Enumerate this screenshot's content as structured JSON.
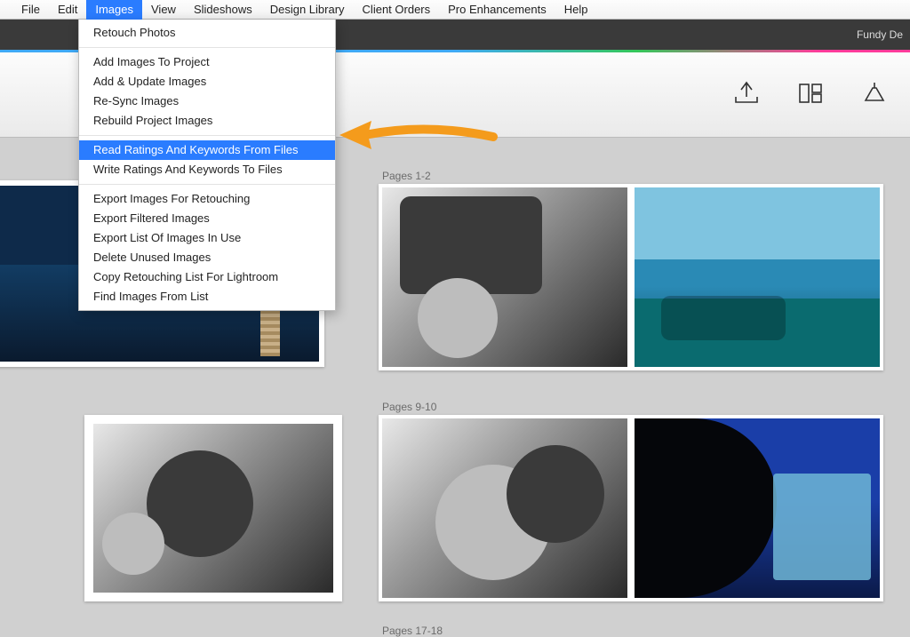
{
  "menubar": {
    "items": [
      "File",
      "Edit",
      "Images",
      "View",
      "Slideshows",
      "Design Library",
      "Client Orders",
      "Pro Enhancements",
      "Help"
    ],
    "open_index": 2
  },
  "titlebar": {
    "right_text": "Fundy De"
  },
  "dropdown": {
    "groups": [
      [
        "Retouch Photos"
      ],
      [
        "Add Images To Project",
        "Add & Update Images",
        "Re-Sync Images",
        "Rebuild Project Images"
      ],
      [
        "Read Ratings And Keywords From Files",
        "Write Ratings And Keywords To Files"
      ],
      [
        "Export Images For Retouching",
        "Export Filtered Images",
        "Export List Of Images In Use",
        "Delete Unused Images",
        "Copy Retouching List For Lightroom",
        "Find Images From List"
      ]
    ],
    "highlighted": "Read Ratings And Keywords From Files"
  },
  "toolbar_icons": [
    "export-icon",
    "layout-icon",
    "share-icon"
  ],
  "spreads": [
    {
      "label": "Pages 1-2"
    },
    {
      "label": "Pages 9-10"
    },
    {
      "label": "Pages 17-18"
    }
  ],
  "annotation": {
    "color": "#f49b1c"
  }
}
